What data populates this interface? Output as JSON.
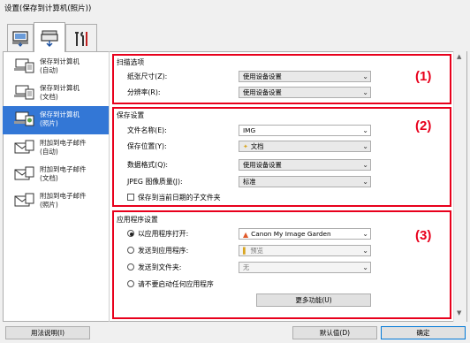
{
  "window": {
    "title": "设置(保存到计算机(照片))"
  },
  "tabs": [
    {
      "name": "scan-from-computer",
      "icon": "computer-scan-icon"
    },
    {
      "name": "scan-from-operation-panel",
      "icon": "scanner-icon"
    },
    {
      "name": "general-settings",
      "icon": "tools-icon"
    }
  ],
  "sidebar": {
    "items": [
      {
        "label": "保存到计算机\n(自动)",
        "icon": "save-to-computer-icon"
      },
      {
        "label": "保存到计算机\n(文档)",
        "icon": "save-to-computer-icon"
      },
      {
        "label": "保存到计算机\n(照片)",
        "icon": "save-to-computer-icon",
        "selected": true
      },
      {
        "label": "附加到电子邮件\n(自动)",
        "icon": "email-attach-icon"
      },
      {
        "label": "附加到电子邮件\n(文档)",
        "icon": "email-attach-icon"
      },
      {
        "label": "附加到电子邮件\n(照片)",
        "icon": "email-attach-icon"
      }
    ]
  },
  "scan_options": {
    "title": "扫描选项",
    "paper_size_label": "纸张尺寸(Z):",
    "paper_size_value": "使用设备设置",
    "resolution_label": "分辨率(R):",
    "resolution_value": "使用设备设置",
    "marker": "(1)"
  },
  "save_settings": {
    "title": "保存设置",
    "file_name_label": "文件名称(E):",
    "file_name_value": "IMG",
    "save_in_label": "保存位置(Y):",
    "save_in_value": "文档",
    "data_format_label": "数据格式(Q):",
    "data_format_value": "使用设备设置",
    "jpeg_quality_label": "JPEG 图像质量(J):",
    "jpeg_quality_value": "标准",
    "subfolder_label": "保存到当前日期的子文件夹",
    "subfolder_checked": false,
    "marker": "(2)"
  },
  "app_settings": {
    "title": "应用程序设置",
    "open_with_label": "以应用程序打开:",
    "open_with_value": "Canon My Image Garden",
    "send_to_app_label": "发送到应用程序:",
    "send_to_app_value": "预览",
    "send_to_folder_label": "发送到文件夹:",
    "send_to_folder_value": "无",
    "no_app_label": "请不要启动任何应用程序",
    "more_functions_label": "更多功能(U)",
    "selected_option": "open_with",
    "marker": "(3)"
  },
  "footer": {
    "instructions_label": "用法说明(I)",
    "defaults_label": "默认值(D)",
    "ok_label": "确定"
  },
  "colors": {
    "accent_red": "#e8001c",
    "selected_blue": "#3377d6"
  }
}
